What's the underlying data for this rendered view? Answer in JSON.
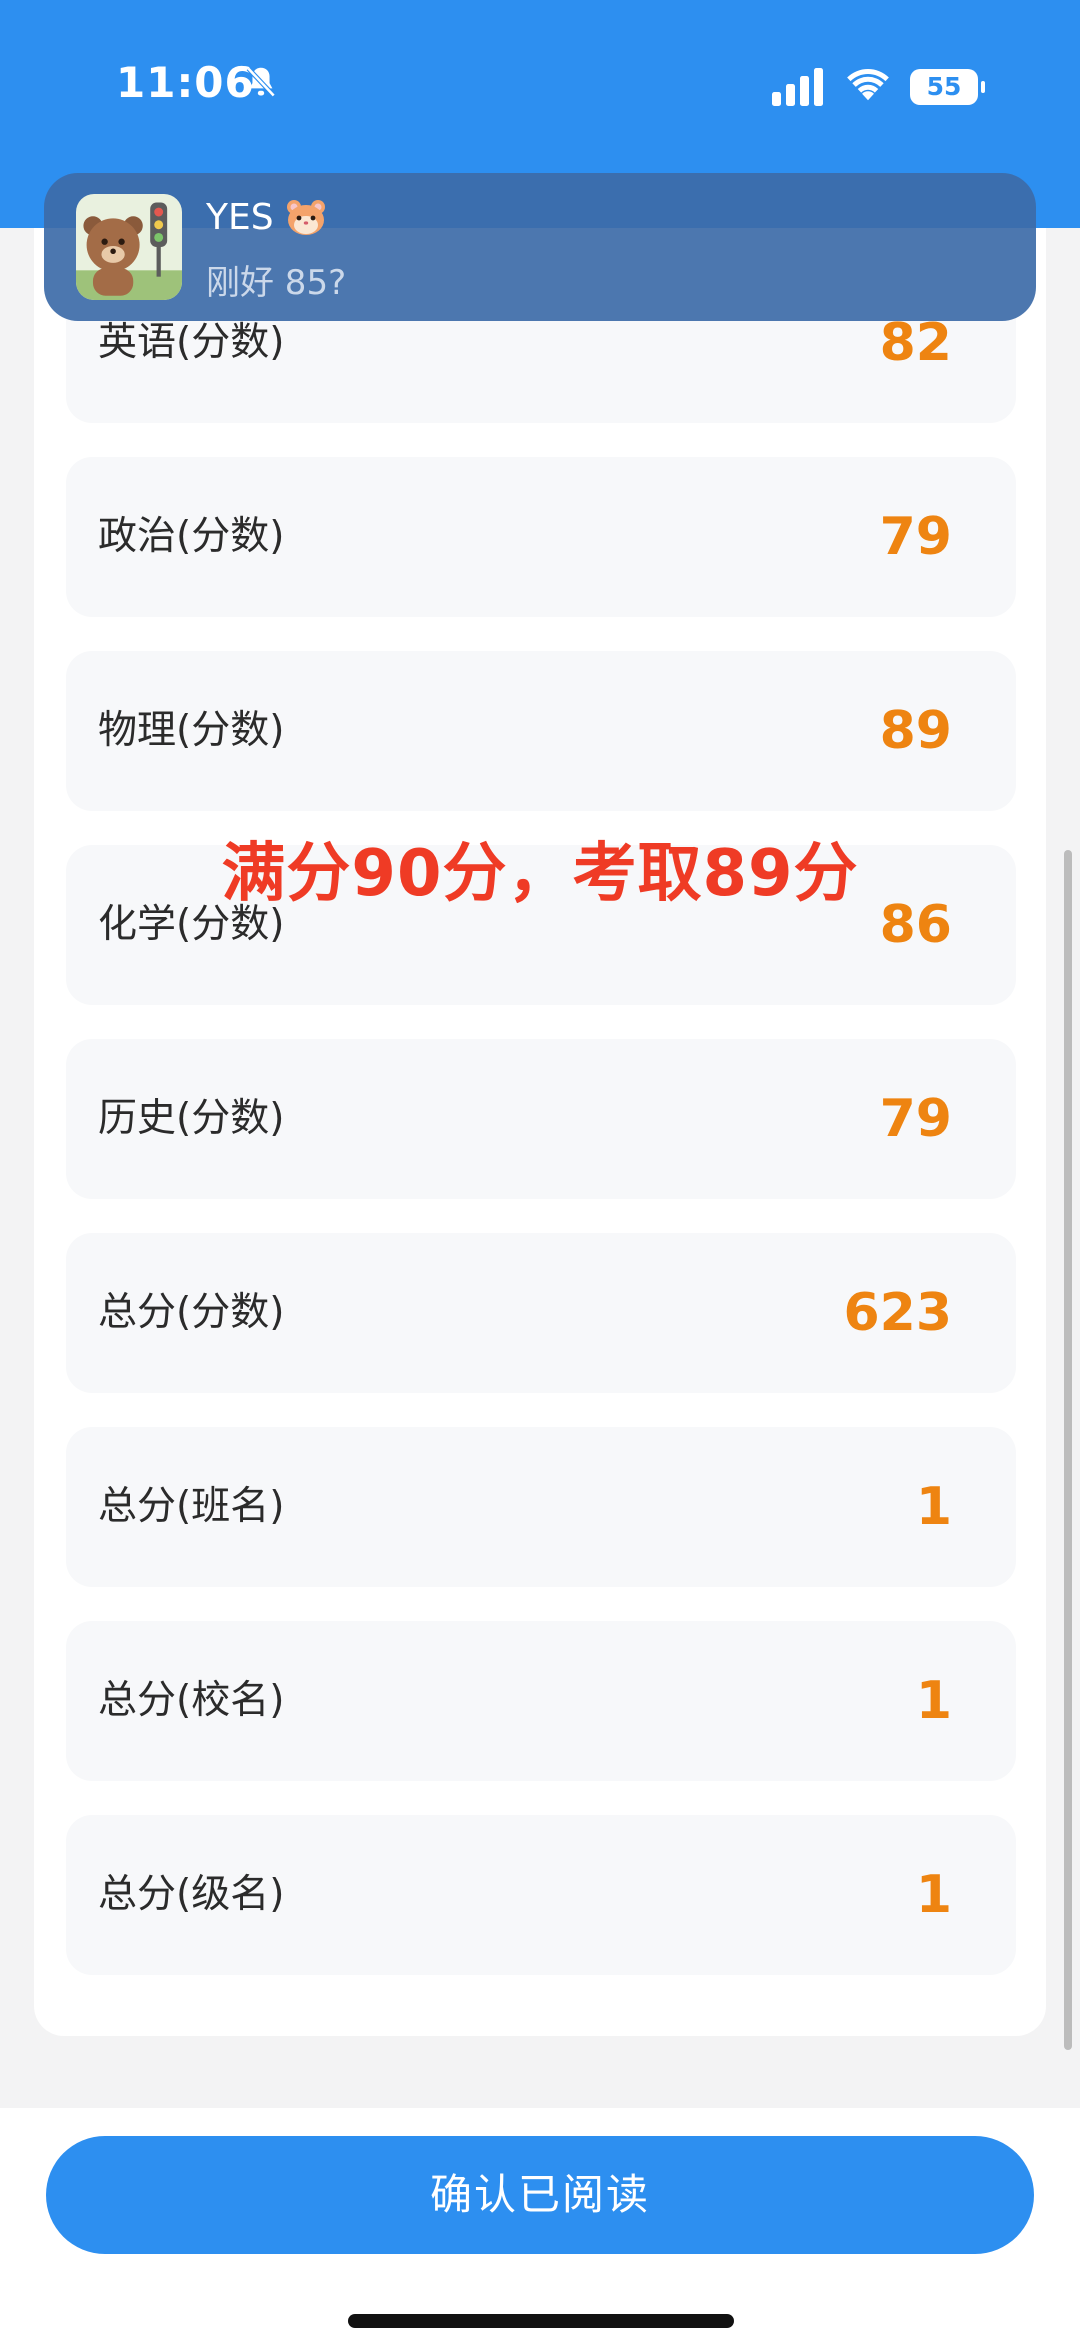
{
  "status_bar": {
    "time": "11:06",
    "battery": "55"
  },
  "notification": {
    "sender": "YES",
    "emoji_icon": "hamster-face-emoji",
    "message": "刚好 85?"
  },
  "scores": [
    {
      "label": "英语(分数)",
      "value": "82"
    },
    {
      "label": "政治(分数)",
      "value": "79"
    },
    {
      "label": "物理(分数)",
      "value": "89"
    },
    {
      "label": "化学(分数)",
      "value": "86"
    },
    {
      "label": "历史(分数)",
      "value": "79"
    },
    {
      "label": "总分(分数)",
      "value": "623"
    },
    {
      "label": "总分(班名)",
      "value": "1"
    },
    {
      "label": "总分(校名)",
      "value": "1"
    },
    {
      "label": "总分(级名)",
      "value": "1"
    }
  ],
  "annotation": "满分90分，考取89分",
  "confirm_button": "确认已阅读",
  "colors": {
    "brand_blue": "#2d8ff0",
    "score_orange": "#ee8411",
    "annotation_red": "#ef3b25"
  }
}
